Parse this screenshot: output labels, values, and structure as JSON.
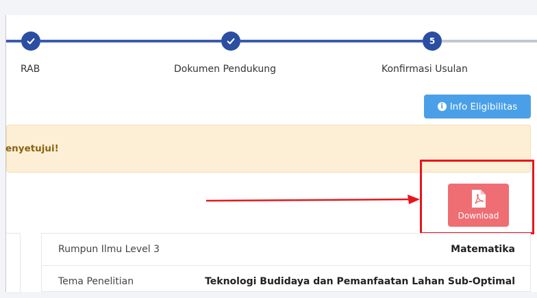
{
  "stepper": {
    "steps": [
      {
        "label": "RAB",
        "status": "completed",
        "number": ""
      },
      {
        "label": "Dokumen Pendukung",
        "status": "completed",
        "number": ""
      },
      {
        "label": "Konfirmasi Usulan",
        "status": "current",
        "number": "5"
      }
    ]
  },
  "info_button": {
    "label": "Info Eligibilitas",
    "icon": "info-circle-icon"
  },
  "alert": {
    "text": "enyetujui!",
    "color": "#fcefd6"
  },
  "download_button": {
    "label": "Download",
    "icon": "pdf-file-icon",
    "color": "#ee6e73"
  },
  "table": {
    "rows": [
      {
        "label": "Rumpun Ilmu Level 3",
        "value": "Matematika"
      },
      {
        "label": "Tema Penelitian",
        "value": "Teknologi Budidaya dan Pemanfaatan Lahan Sub-Optimal"
      }
    ]
  },
  "colors": {
    "step_primary": "#2b4ea3",
    "step_pending": "#c2c7d0",
    "info": "#4aa0e8",
    "annotation_red": "#e8141a"
  }
}
